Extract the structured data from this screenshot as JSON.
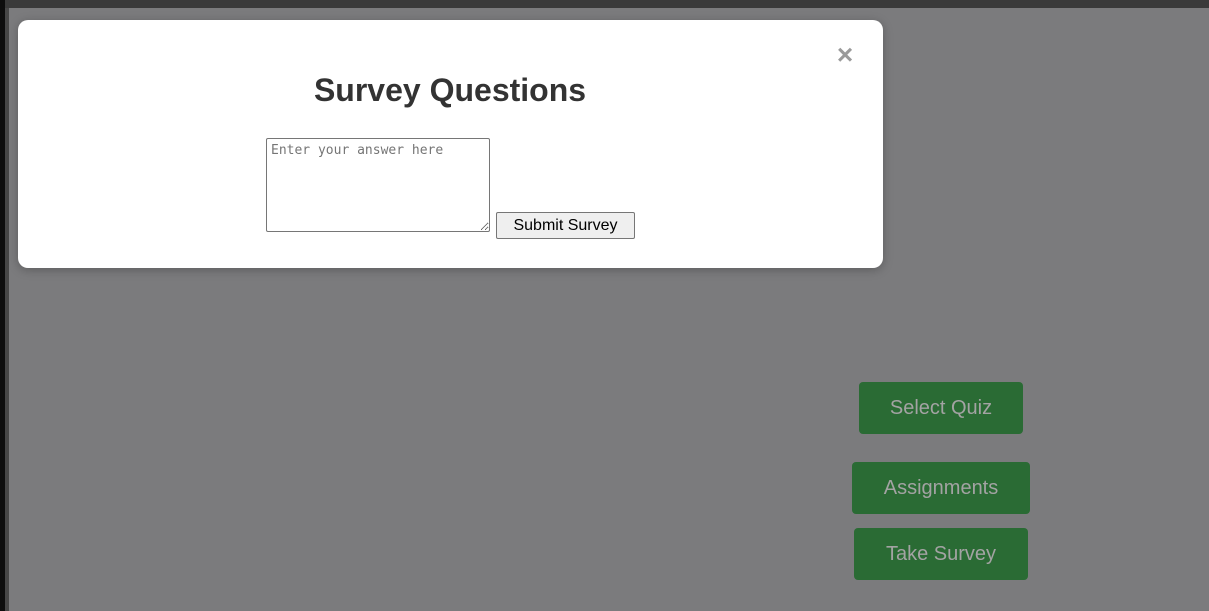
{
  "modal": {
    "close_glyph": "×",
    "title": "Survey Questions",
    "answer_placeholder": "Enter your answer here",
    "submit_label": "Submit Survey"
  },
  "actions": {
    "select_quiz_label": "Select Quiz",
    "assignments_label": "Assignments",
    "take_survey_label": "Take Survey"
  },
  "colors": {
    "overlay": "#7b7b7d",
    "button_green": "#2a6b34",
    "modal_bg": "#ffffff",
    "title_text": "#333333"
  },
  "icons": {
    "close": "close-icon"
  }
}
